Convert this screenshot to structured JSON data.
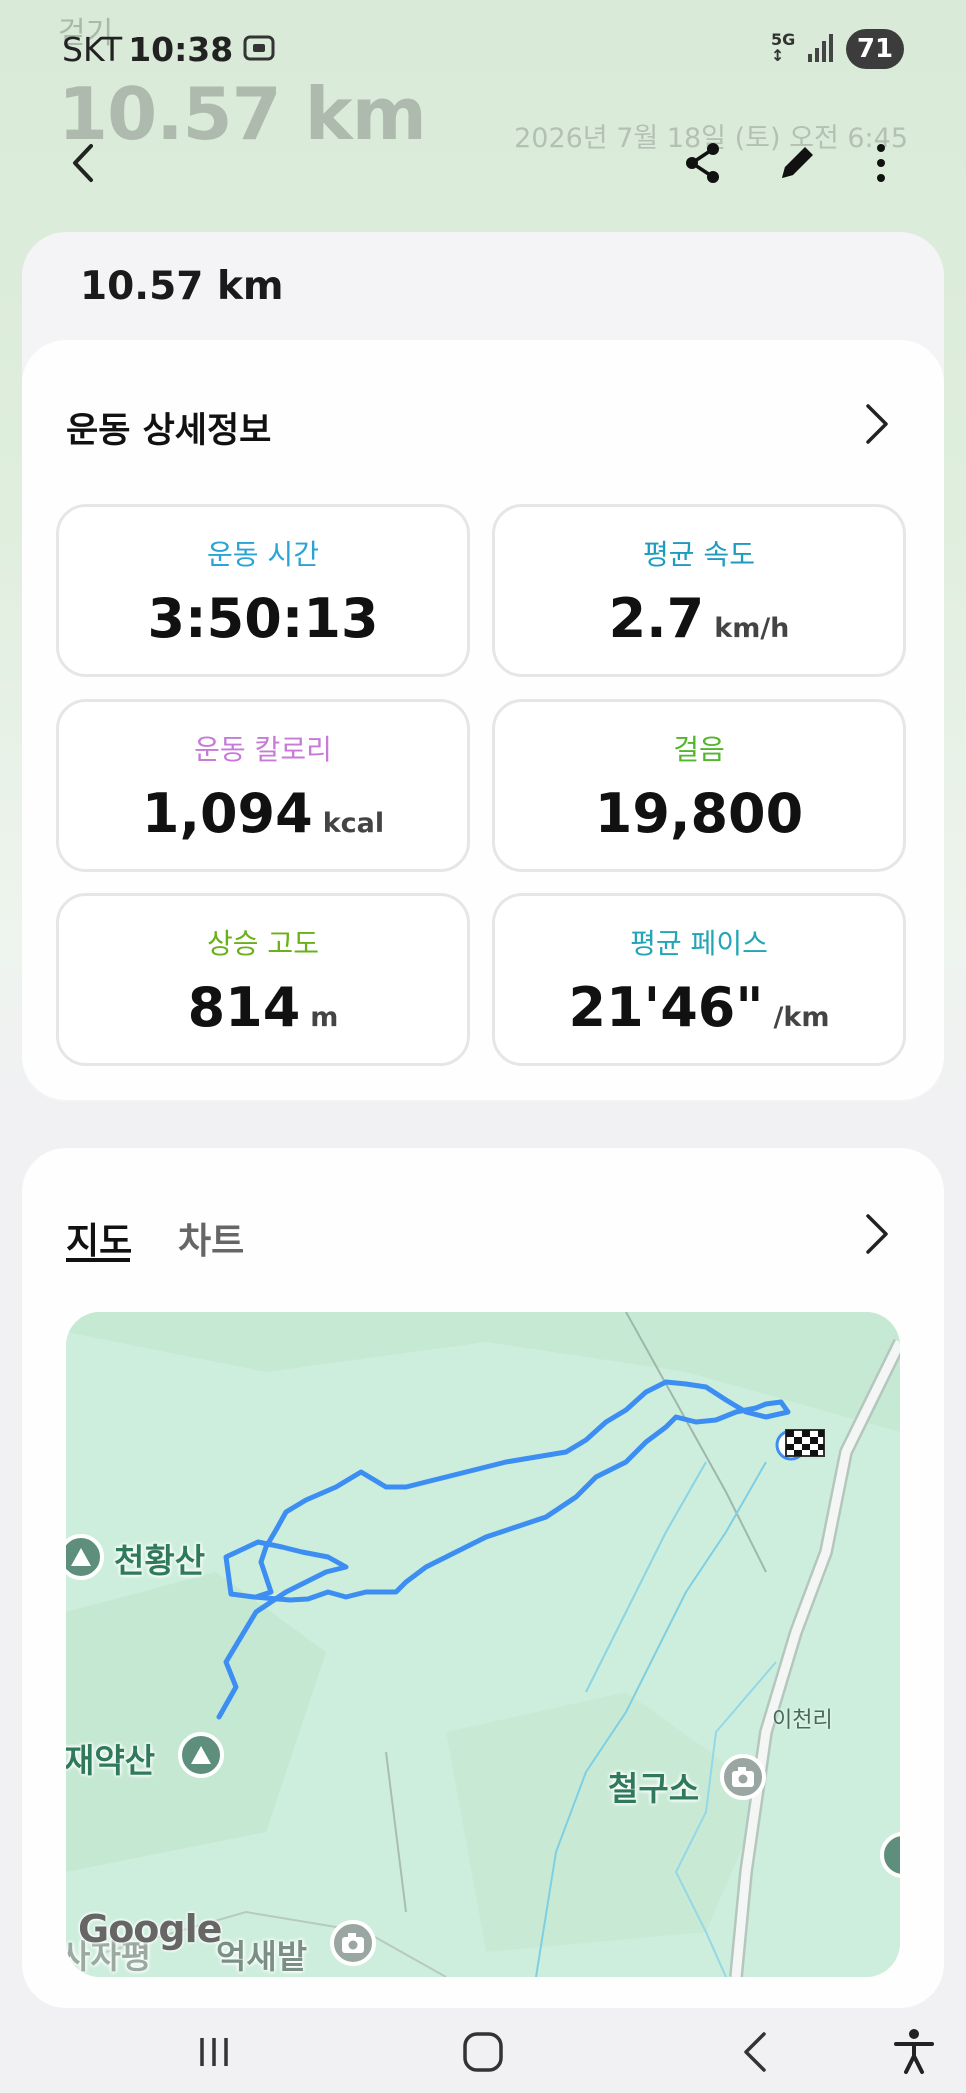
{
  "status_bar": {
    "carrier": "SKT",
    "time": "10:38",
    "network": "5G",
    "battery": "71"
  },
  "hero": {
    "activity": "걷기",
    "distance": "10.57 km",
    "datetime": "2026년 7월 18일 (토) 오전 6:45"
  },
  "summary": {
    "distance": "10.57 km"
  },
  "details": {
    "title": "운동 상세정보",
    "tiles": [
      {
        "label": "운동 시간",
        "value": "3:50:13",
        "unit": "",
        "color": "#2aa3d6"
      },
      {
        "label": "평균 속도",
        "value": "2.7",
        "unit": "km/h",
        "color": "#1d9bc0"
      },
      {
        "label": "운동 칼로리",
        "value": "1,094",
        "unit": "kcal",
        "color": "#c77ad8"
      },
      {
        "label": "걸음",
        "value": "19,800",
        "unit": "",
        "color": "#52b62b"
      },
      {
        "label": "상승 고도",
        "value": "814",
        "unit": "m",
        "color": "#6ab019"
      },
      {
        "label": "평균 페이스",
        "value": "21'46\"",
        "unit": "/km",
        "color": "#22a6b6"
      }
    ]
  },
  "map_section": {
    "tabs": [
      "지도",
      "차트"
    ],
    "labels": {
      "cheonhwang": "천황산",
      "jaeyak": "재약산",
      "cheolgu": "철구소",
      "icheon": "이천리",
      "eoksae": "억새밭",
      "left_partial": "사자평"
    },
    "attribution": "Google"
  }
}
